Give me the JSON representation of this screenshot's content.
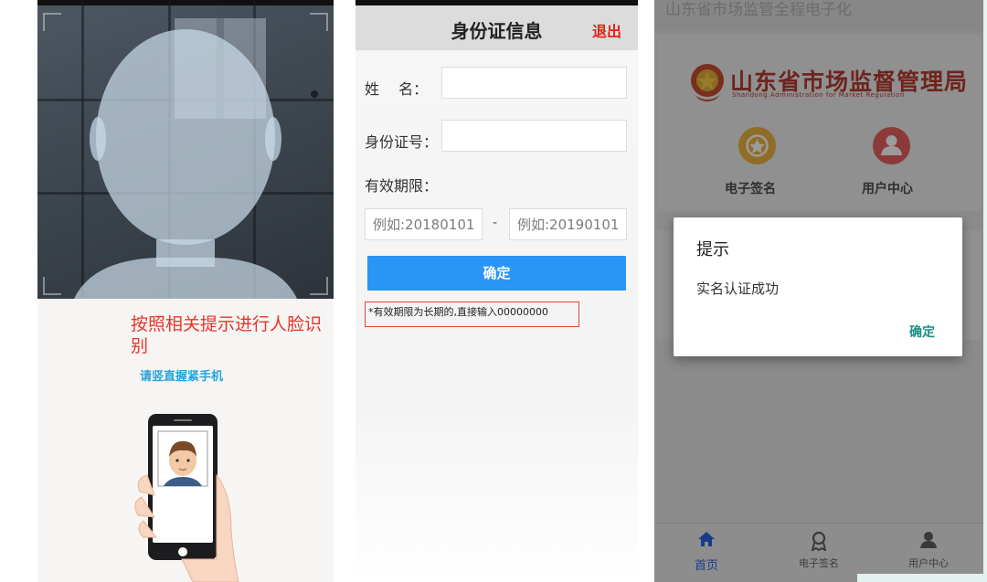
{
  "face_panel": {
    "instruction_red": "按照相关提示进行人脸识别",
    "instruction_blue": "请竖直握紧手机"
  },
  "id_form": {
    "title": "身份证信息",
    "exit_label": "退出",
    "name_label": "姓　 名：",
    "id_label": "身份证号：",
    "validity_label": "有效期限：",
    "start_placeholder": "例如:20180101",
    "end_placeholder": "例如:20190101",
    "separator": "-",
    "confirm_label": "确定",
    "note": "*有效期限为长期的,直接输入00000000"
  },
  "app": {
    "window_title": "山东省市场监管全程电子化",
    "org_name_cn": "山东省市场监督管理局",
    "org_name_en": "Shandong Administration for Market Regulation",
    "tiles": [
      {
        "label": "电子签名",
        "icon": "seal-icon"
      },
      {
        "label": "用户中心",
        "icon": "user-icon"
      }
    ],
    "dialog": {
      "title": "提示",
      "message": "实名认证成功",
      "ok_label": "确定"
    },
    "tabs": [
      {
        "label": "首页",
        "icon": "home-icon",
        "active": true
      },
      {
        "label": "电子签名",
        "icon": "signature-icon",
        "active": false
      },
      {
        "label": "用户中心",
        "icon": "person-icon",
        "active": false
      }
    ]
  },
  "colors": {
    "red_text": "#e8332a",
    "blue_text": "#23a3dd",
    "confirm_blue": "#2a95f5",
    "dialog_ok_teal": "#1a8f84",
    "tab_active": "#1a3b8c"
  }
}
